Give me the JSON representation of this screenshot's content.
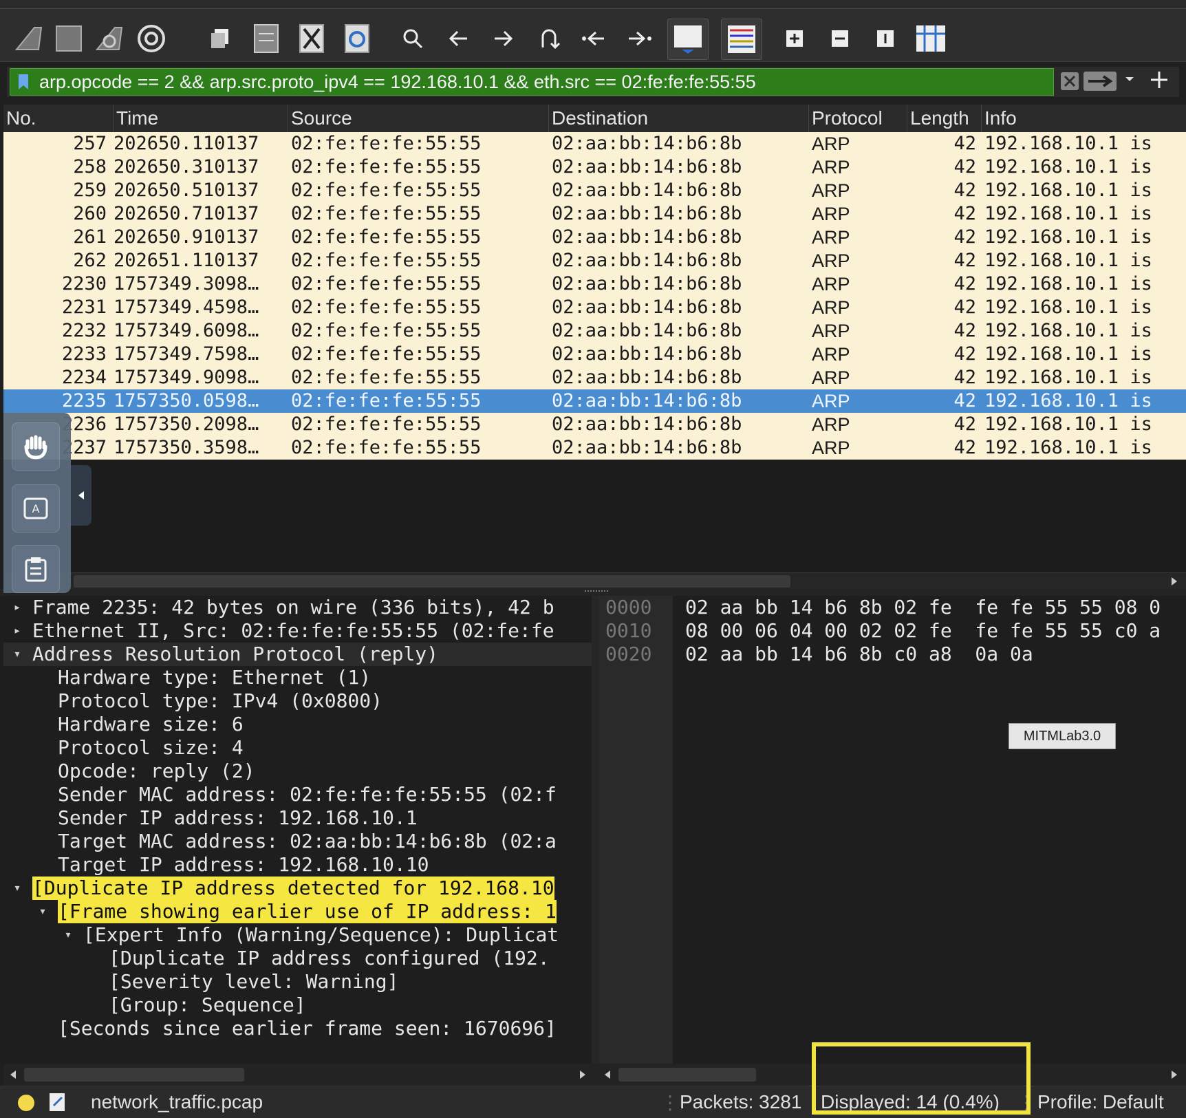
{
  "toolbar": {
    "buttons": [
      "shark-fin-start-icon",
      "stop-square-icon",
      "shark-fin-restart-icon",
      "options-gear-icon",
      "open-file-icon",
      "save-file-icon",
      "close-file-icon",
      "reload-file-icon",
      "search-icon",
      "arrow-left-icon",
      "arrow-right-icon",
      "go-to-packet-icon",
      "first-packet-icon",
      "last-packet-icon",
      "autoscroll-icon",
      "colorize-icon",
      "zoom-in-icon",
      "zoom-out-icon",
      "normal-size-icon",
      "resize-columns-icon"
    ]
  },
  "filter": {
    "expression": "arp.opcode == 2 && arp.src.proto_ipv4 == 192.168.10.1 && eth.src == 02:fe:fe:fe:55:55",
    "bg_color": "#2e7d1b"
  },
  "packet_list": {
    "columns": [
      "No.",
      "Time",
      "Source",
      "Destination",
      "Protocol",
      "Length",
      "Info"
    ],
    "rows": [
      {
        "no": "257",
        "time": "202650.110137",
        "source": "02:fe:fe:fe:55:55",
        "destination": "02:aa:bb:14:b6:8b",
        "protocol": "ARP",
        "length": "42",
        "info": "192.168.10.1 is"
      },
      {
        "no": "258",
        "time": "202650.310137",
        "source": "02:fe:fe:fe:55:55",
        "destination": "02:aa:bb:14:b6:8b",
        "protocol": "ARP",
        "length": "42",
        "info": "192.168.10.1 is"
      },
      {
        "no": "259",
        "time": "202650.510137",
        "source": "02:fe:fe:fe:55:55",
        "destination": "02:aa:bb:14:b6:8b",
        "protocol": "ARP",
        "length": "42",
        "info": "192.168.10.1 is"
      },
      {
        "no": "260",
        "time": "202650.710137",
        "source": "02:fe:fe:fe:55:55",
        "destination": "02:aa:bb:14:b6:8b",
        "protocol": "ARP",
        "length": "42",
        "info": "192.168.10.1 is"
      },
      {
        "no": "261",
        "time": "202650.910137",
        "source": "02:fe:fe:fe:55:55",
        "destination": "02:aa:bb:14:b6:8b",
        "protocol": "ARP",
        "length": "42",
        "info": "192.168.10.1 is"
      },
      {
        "no": "262",
        "time": "202651.110137",
        "source": "02:fe:fe:fe:55:55",
        "destination": "02:aa:bb:14:b6:8b",
        "protocol": "ARP",
        "length": "42",
        "info": "192.168.10.1 is"
      },
      {
        "no": "2230",
        "time": "1757349.3098…",
        "source": "02:fe:fe:fe:55:55",
        "destination": "02:aa:bb:14:b6:8b",
        "protocol": "ARP",
        "length": "42",
        "info": "192.168.10.1 is"
      },
      {
        "no": "2231",
        "time": "1757349.4598…",
        "source": "02:fe:fe:fe:55:55",
        "destination": "02:aa:bb:14:b6:8b",
        "protocol": "ARP",
        "length": "42",
        "info": "192.168.10.1 is"
      },
      {
        "no": "2232",
        "time": "1757349.6098…",
        "source": "02:fe:fe:fe:55:55",
        "destination": "02:aa:bb:14:b6:8b",
        "protocol": "ARP",
        "length": "42",
        "info": "192.168.10.1 is"
      },
      {
        "no": "2233",
        "time": "1757349.7598…",
        "source": "02:fe:fe:fe:55:55",
        "destination": "02:aa:bb:14:b6:8b",
        "protocol": "ARP",
        "length": "42",
        "info": "192.168.10.1 is"
      },
      {
        "no": "2234",
        "time": "1757349.9098…",
        "source": "02:fe:fe:fe:55:55",
        "destination": "02:aa:bb:14:b6:8b",
        "protocol": "ARP",
        "length": "42",
        "info": "192.168.10.1 is"
      },
      {
        "no": "2235",
        "time": "1757350.0598…",
        "source": "02:fe:fe:fe:55:55",
        "destination": "02:aa:bb:14:b6:8b",
        "protocol": "ARP",
        "length": "42",
        "info": "192.168.10.1 is",
        "selected": true
      },
      {
        "no": "2236",
        "time": "1757350.2098…",
        "source": "02:fe:fe:fe:55:55",
        "destination": "02:aa:bb:14:b6:8b",
        "protocol": "ARP",
        "length": "42",
        "info": "192.168.10.1 is"
      },
      {
        "no": "2237",
        "time": "1757350.3598…",
        "source": "02:fe:fe:fe:55:55",
        "destination": "02:aa:bb:14:b6:8b",
        "protocol": "ARP",
        "length": "42",
        "info": "192.168.10.1 is"
      }
    ],
    "row_bg": "#fbf1d5",
    "selected_bg": "#4a8cd0"
  },
  "details": {
    "lines": [
      {
        "text": "Frame 2235: 42 bytes on wire (336 bits), 42 b",
        "level": 0,
        "arrow": "right"
      },
      {
        "text": "Ethernet II, Src: 02:fe:fe:fe:55:55 (02:fe:fe",
        "level": 0,
        "arrow": "right"
      },
      {
        "text": "Address Resolution Protocol (reply)",
        "level": 0,
        "arrow": "down",
        "bg": true
      },
      {
        "text": "Hardware type: Ethernet (1)",
        "level": 1,
        "arrow": ""
      },
      {
        "text": "Protocol type: IPv4 (0x0800)",
        "level": 1,
        "arrow": ""
      },
      {
        "text": "Hardware size: 6",
        "level": 1,
        "arrow": ""
      },
      {
        "text": "Protocol size: 4",
        "level": 1,
        "arrow": ""
      },
      {
        "text": "Opcode: reply (2)",
        "level": 1,
        "arrow": ""
      },
      {
        "text": "Sender MAC address: 02:fe:fe:fe:55:55 (02:f",
        "level": 1,
        "arrow": ""
      },
      {
        "text": "Sender IP address: 192.168.10.1",
        "level": 1,
        "arrow": ""
      },
      {
        "text": "Target MAC address: 02:aa:bb:14:b6:8b (02:a",
        "level": 1,
        "arrow": ""
      },
      {
        "text": "Target IP address: 192.168.10.10",
        "level": 1,
        "arrow": ""
      },
      {
        "text": "[Duplicate IP address detected for 192.168.10",
        "level": 0,
        "arrow": "down",
        "highlight": true
      },
      {
        "text": "[Frame showing earlier use of IP address: 1",
        "level": 1,
        "arrow": "down",
        "highlight": true
      },
      {
        "text": "[Expert Info (Warning/Sequence): Duplicat",
        "level": 2,
        "arrow": "down"
      },
      {
        "text": "[Duplicate IP address configured (192.",
        "level": 3,
        "arrow": ""
      },
      {
        "text": "[Severity level: Warning]",
        "level": 3,
        "arrow": ""
      },
      {
        "text": "[Group: Sequence]",
        "level": 3,
        "arrow": ""
      },
      {
        "text": "[Seconds since earlier frame seen: 1670696]",
        "level": 1,
        "arrow": ""
      }
    ],
    "highlight_color": "#f5e642"
  },
  "hex": {
    "offsets": [
      "0000",
      "0010",
      "0020"
    ],
    "bytes": [
      "02 aa bb 14 b6 8b 02 fe  fe fe 55 55 08 0",
      "08 00 06 04 00 02 02 fe  fe fe 55 55 c0 a",
      "02 aa bb 14 b6 8b c0 a8  0a 0a"
    ]
  },
  "tooltip": "MITMLab3.0",
  "side_panel": [
    "hand-tool-icon",
    "keyboard-a-icon",
    "clipboard-icon"
  ],
  "status": {
    "filename": "network_traffic.pcap",
    "packets": "Packets: 3281",
    "displayed": "Displayed: 14 (0.4%)",
    "profile": "Profile: Default"
  },
  "annotation_color": "#f0e443"
}
